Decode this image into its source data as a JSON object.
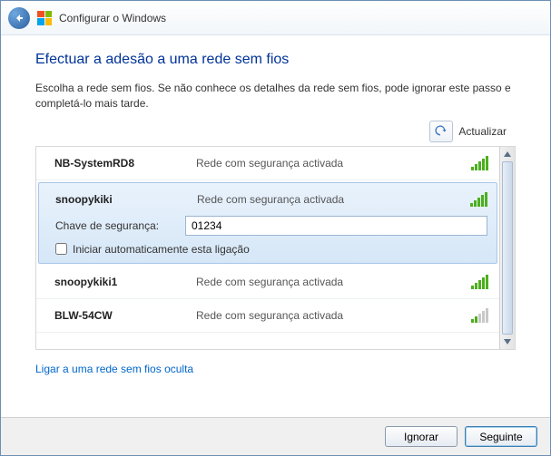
{
  "header": {
    "title": "Configurar o Windows"
  },
  "page": {
    "title": "Efectuar a adesão a uma rede sem fios",
    "instruction": "Escolha a rede sem fios. Se não conhece os detalhes da rede sem fios, pode ignorar este passo e completá-lo mais tarde.",
    "refresh_label": "Actualizar",
    "hidden_link": "Ligar a uma rede sem fios oculta"
  },
  "networks": [
    {
      "name": "NB-SystemRD8",
      "status": "Rede com segurança activada",
      "signal": "full"
    },
    {
      "name": "snoopykiki",
      "status": "Rede com segurança activada",
      "signal": "full"
    },
    {
      "name": "snoopykiki1",
      "status": "Rede com segurança activada",
      "signal": "full"
    },
    {
      "name": "BLW-54CW",
      "status": "Rede com segurança activada",
      "signal": "partial"
    }
  ],
  "selected": {
    "key_label": "Chave de segurança:",
    "key_value": "01234",
    "auto_label": "Iniciar automaticamente esta ligação"
  },
  "footer": {
    "skip": "Ignorar",
    "next": "Seguinte"
  }
}
